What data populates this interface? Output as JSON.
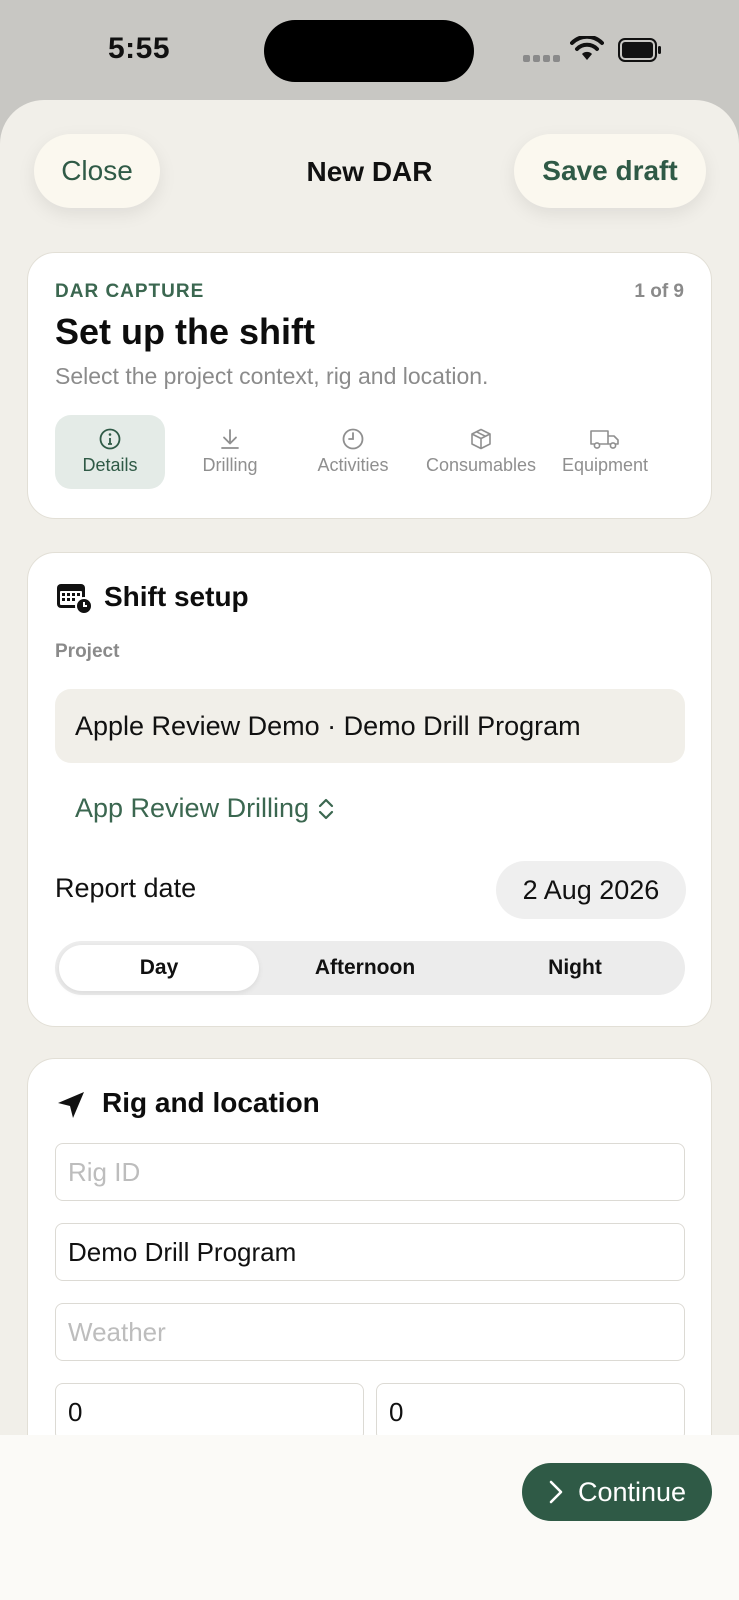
{
  "status_bar": {
    "time": "5:55"
  },
  "nav": {
    "close_label": "Close",
    "title": "New DAR",
    "save_label": "Save draft"
  },
  "header_card": {
    "eyebrow": "DAR CAPTURE",
    "step": "1 of 9",
    "title": "Set up the shift",
    "subtitle": "Select the project context, rig and location.",
    "tabs": [
      {
        "label": "Details",
        "icon": "info-icon",
        "active": true
      },
      {
        "label": "Drilling",
        "icon": "download-icon",
        "active": false
      },
      {
        "label": "Activities",
        "icon": "clock-icon",
        "active": false
      },
      {
        "label": "Consumables",
        "icon": "box-icon",
        "active": false
      },
      {
        "label": "Equipment",
        "icon": "truck-icon",
        "active": false
      }
    ]
  },
  "shift_setup": {
    "title": "Shift setup",
    "project_label": "Project",
    "project_value": "Apple Review Demo · Demo Drill Program",
    "picker_value": "App Review Drilling",
    "report_date_label": "Report date",
    "report_date_value": "2 Aug 2026",
    "shifts": [
      "Day",
      "Afternoon",
      "Night"
    ],
    "selected_shift": "Day"
  },
  "rig_location": {
    "title": "Rig and location",
    "rig_id_placeholder": "Rig ID",
    "program_value": "Demo Drill Program",
    "weather_placeholder": "Weather",
    "field_left_value": "0",
    "field_right_value": "0"
  },
  "footer": {
    "continue_label": "Continue"
  },
  "colors": {
    "accent": "#2f5a46",
    "background": "#f1efe9",
    "card": "#ffffff",
    "muted": "#8a8a8a"
  }
}
